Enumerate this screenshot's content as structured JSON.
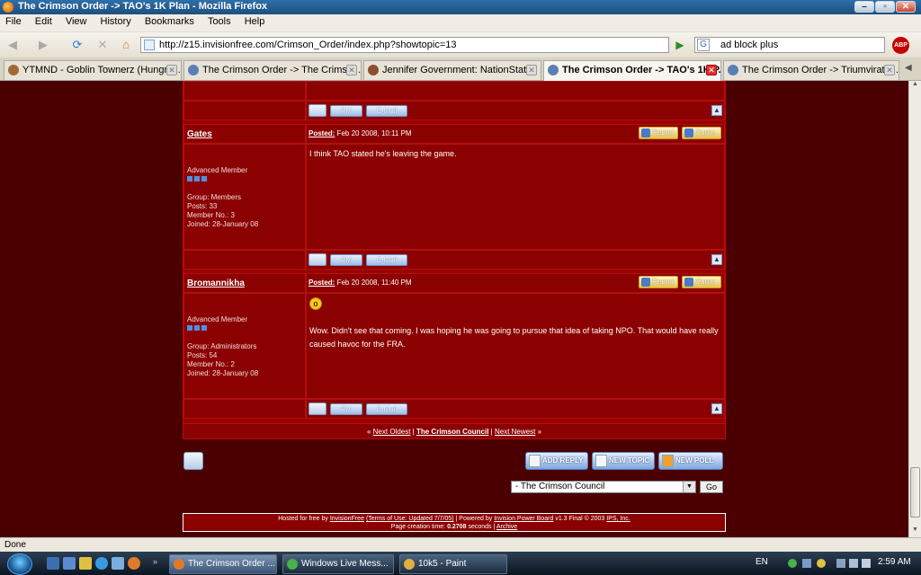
{
  "window": {
    "title": "The Crimson Order -> TAO's 1K Plan - Mozilla Firefox"
  },
  "menu": [
    "File",
    "Edit",
    "View",
    "History",
    "Bookmarks",
    "Tools",
    "Help"
  ],
  "url": "http://z15.invisionfree.com/Crimson_Order/index.php?showtopic=13",
  "search": {
    "value": "ad block plus"
  },
  "abp_label": "ABP",
  "tabs": [
    {
      "label": "YTMND - Goblin Townerz (Hungry ..."
    },
    {
      "label": "The Crimson Order -> The Crimso..."
    },
    {
      "label": "Jennifer Government: NationStates ..."
    },
    {
      "label": "The Crimson Order -> TAO's 1K P..."
    },
    {
      "label": "The Crimson Order -> Triumvirate: ..."
    }
  ],
  "post_buttons": {
    "pm": "PM",
    "email": "E-Mail",
    "report": "Report",
    "quote": "Quote"
  },
  "posts": [
    {
      "author": "Gates",
      "rank": "Advanced Member",
      "group": "Group: Members",
      "posts": "Posts: 33",
      "member_no": "Member No.: 3",
      "joined": "Joined: 28-January 08",
      "posted_label": "Posted:",
      "date": "Feb 20 2008, 10:11 PM",
      "message": "I think TAO stated he's leaving the game."
    },
    {
      "author": "Bromannikha",
      "rank": "Advanced Member",
      "group": "Group: Administrators",
      "posts": "Posts: 54",
      "member_no": "Member No.: 2",
      "joined": "Joined: 28-January 08",
      "posted_label": "Posted:",
      "date": "Feb 20 2008, 11:40 PM",
      "message": "Wow. Didn't see that coming. I was hoping he was going to pursue that idea of taking NPO. That would have really caused havoc for the FRA."
    }
  ],
  "pager": {
    "prefix": "«",
    "oldest": "Next Oldest",
    "sep1": "|",
    "council": "The Crimson Council",
    "sep2": "|",
    "newest": "Next Newest",
    "suffix": "»"
  },
  "actions": {
    "add_reply": "ADD REPLY",
    "new_topic": "NEW TOPIC",
    "new_poll": "NEW POLL"
  },
  "jump": {
    "selected": "- The Crimson Council",
    "go": "Go"
  },
  "footer": {
    "hosted": "Hosted for free by",
    "invisionfree": "InvisionFree",
    "terms": "(Terms of Use: Updated 7/7/05)",
    "powered": "| Powered by",
    "ipb": "Invision Power Board",
    "version": "v1.3 Final © 2003",
    "ips": "IPS, Inc.",
    "creation": "Page creation time:",
    "time": "0.2708",
    "seconds": "seconds |",
    "archive": "Archive"
  },
  "status": "Done",
  "taskbar": {
    "items": [
      {
        "label": "The Crimson Order ..."
      },
      {
        "label": "Windows Live Mess..."
      },
      {
        "label": "10k5 - Paint"
      }
    ],
    "lang": "EN",
    "time": "2:59 AM"
  }
}
